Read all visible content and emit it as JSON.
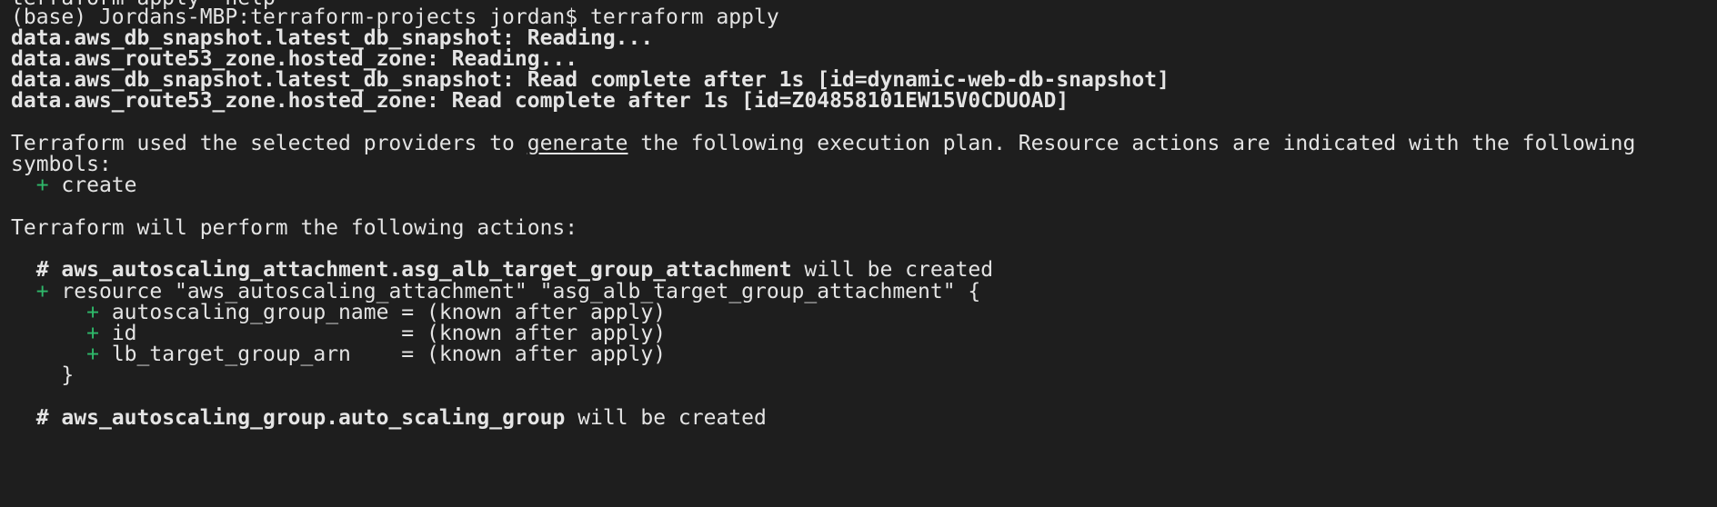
{
  "terminal": {
    "partial_top_line": "terraform apply -help",
    "prompt": "(base) Jordans-MBP:terraform-projects jordan$ terraform apply",
    "reading": [
      {
        "addr": "data.aws_db_snapshot.latest_db_snapshot:",
        "msg": " Reading..."
      },
      {
        "addr": "data.aws_route53_zone.hosted_zone:",
        "msg": " Reading..."
      },
      {
        "addr": "data.aws_db_snapshot.latest_db_snapshot:",
        "msg": " Read complete after 1s [id=dynamic-web-db-snapshot]"
      },
      {
        "addr": "data.aws_route53_zone.hosted_zone:",
        "msg": " Read complete after 1s [id=Z04858101EW15V0CDUOAD]"
      }
    ],
    "plan_intro": {
      "before": "Terraform used the selected providers to ",
      "link": "generate",
      "after": " the following execution plan. Resource actions are indicated with the following",
      "line2": "symbols:"
    },
    "symbols": [
      {
        "sign": "+",
        "label": "create"
      }
    ],
    "actions_heading": "Terraform will perform the following actions:",
    "resources": [
      {
        "comment_hash": "#",
        "address": "aws_autoscaling_attachment.asg_alb_target_group_attachment",
        "status": " will be created",
        "sign": "+",
        "declaration": "resource \"aws_autoscaling_attachment\" \"asg_alb_target_group_attachment\" {",
        "attributes": [
          {
            "sign": "+",
            "text": "autoscaling_group_name = (known after apply)"
          },
          {
            "sign": "+",
            "text": "id                     = (known after apply)"
          },
          {
            "sign": "+",
            "text": "lb_target_group_arn    = (known after apply)"
          }
        ],
        "close": "}"
      },
      {
        "comment_hash": "#",
        "address": "aws_autoscaling_group.auto_scaling_group",
        "status": " will be created"
      }
    ]
  },
  "colors": {
    "background": "#1e1e1e",
    "foreground": "#e4e4e4",
    "add_sign": "#2fb86a"
  }
}
